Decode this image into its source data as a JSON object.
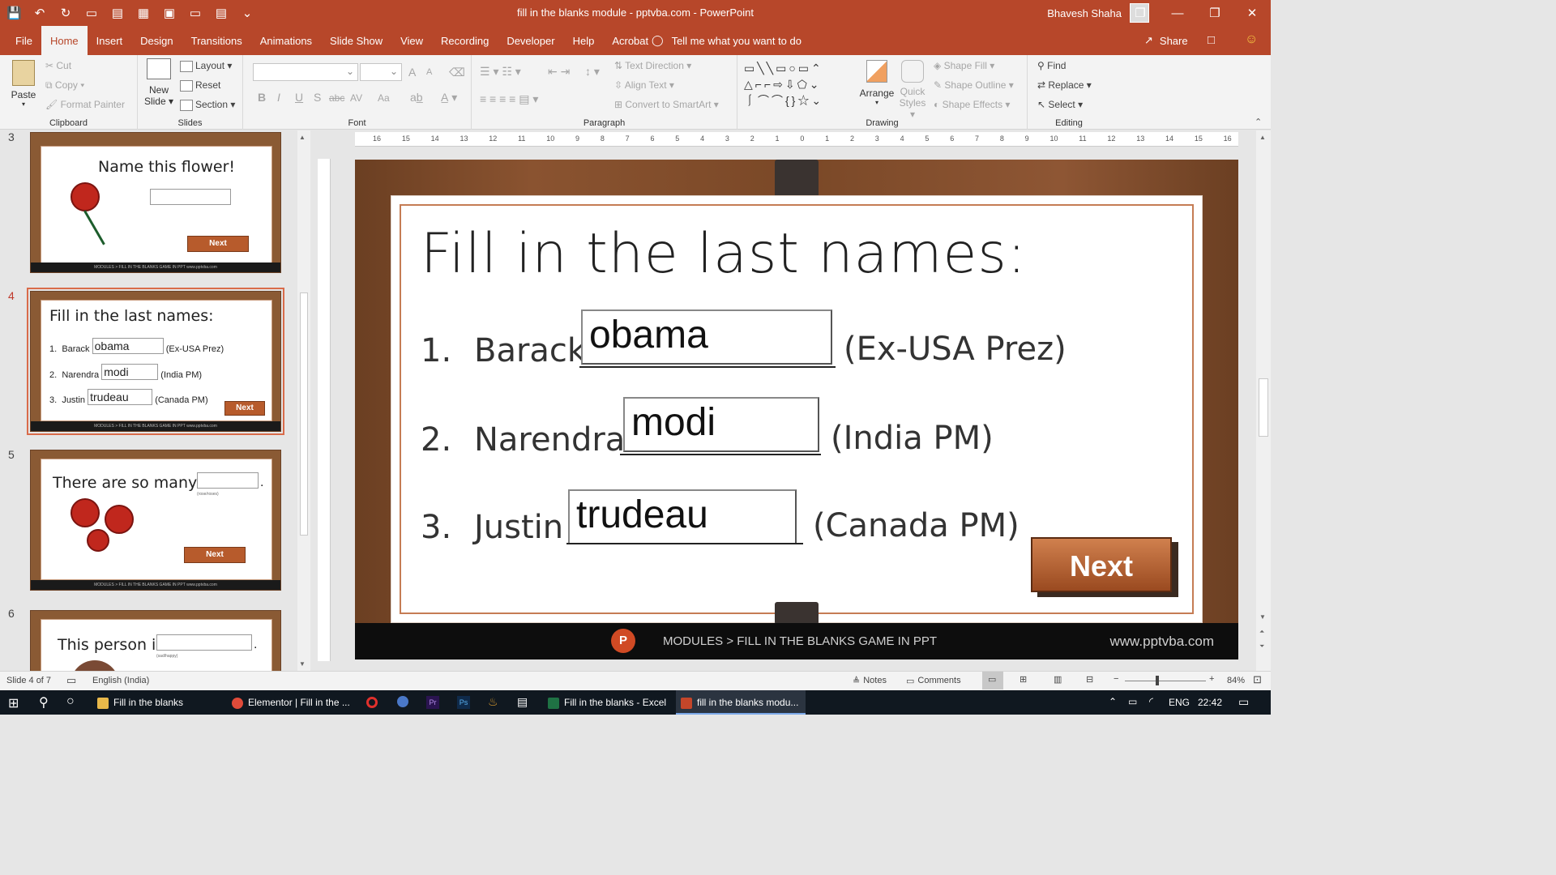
{
  "window": {
    "title": "fill in the blanks module - pptvba.com  -  PowerPoint",
    "user": "Bhavesh Shaha",
    "controls": [
      "❐",
      "—",
      "❐",
      "✕"
    ]
  },
  "quick_access": [
    "💾",
    "↶",
    "↻",
    "▭",
    "▤",
    "▦",
    "▣",
    "▭",
    "▤",
    "⌄"
  ],
  "tabs": [
    "File",
    "Home",
    "Insert",
    "Design",
    "Transitions",
    "Animations",
    "Slide Show",
    "View",
    "Recording",
    "Developer",
    "Help",
    "Acrobat"
  ],
  "tell_me": "Tell me what you want to do",
  "share": "Share",
  "ribbon": {
    "clipboard": {
      "label": "Clipboard",
      "paste": "Paste",
      "cut": "Cut",
      "copy": "Copy",
      "format_painter": "Format Painter"
    },
    "slides": {
      "label": "Slides",
      "new_slide_1": "New",
      "new_slide_2": "Slide",
      "layout": "Layout",
      "reset": "Reset",
      "section": "Section"
    },
    "font": {
      "label": "Font",
      "bold": "B",
      "italic": "I",
      "underline": "U",
      "shadow": "S",
      "strike": "abc",
      "spacing": "AV",
      "case": "Aa",
      "grow": "A",
      "shrink": "A"
    },
    "paragraph": {
      "label": "Paragraph",
      "text_direction": "Text Direction",
      "align_text": "Align Text",
      "convert": "Convert to SmartArt"
    },
    "drawing": {
      "label": "Drawing",
      "arrange": "Arrange",
      "quick_styles_1": "Quick",
      "quick_styles_2": "Styles",
      "shape_fill": "Shape Fill",
      "shape_outline": "Shape Outline",
      "shape_effects": "Shape Effects"
    },
    "editing": {
      "label": "Editing",
      "find": "Find",
      "replace": "Replace",
      "select": "Select"
    }
  },
  "ruler_ticks": [
    "16",
    "15",
    "14",
    "13",
    "12",
    "11",
    "10",
    "9",
    "8",
    "7",
    "6",
    "5",
    "4",
    "3",
    "2",
    "1",
    "0",
    "1",
    "2",
    "3",
    "4",
    "5",
    "6",
    "7",
    "8",
    "9",
    "10",
    "11",
    "12",
    "13",
    "14",
    "15",
    "16"
  ],
  "thumbnails": [
    {
      "num": "3",
      "title": "Name this flower!",
      "next": "Next",
      "footer": "MODULES > FILL IN THE BLANKS GAME IN PPT          www.pptvba.com"
    },
    {
      "num": "4",
      "title": "Fill in the last names:",
      "rows": [
        {
          "n": "1.",
          "first": "Barack",
          "value": "obama",
          "hint": "(Ex-USA Prez)"
        },
        {
          "n": "2.",
          "first": "Narendra",
          "value": "modi",
          "hint": "(India PM)"
        },
        {
          "n": "3.",
          "first": "Justin",
          "value": "trudeau",
          "hint": "(Canada PM)"
        }
      ],
      "next": "Next",
      "footer": "MODULES > FILL IN THE BLANKS GAME IN PPT          www.pptvba.com"
    },
    {
      "num": "5",
      "title": "There are so many",
      "dot": ".",
      "sub": "(rose/roses)",
      "next": "Next",
      "footer": "MODULES > FILL IN THE BLANKS GAME IN PPT          www.pptvba.com"
    },
    {
      "num": "6",
      "title": "This person is",
      "dot": ".",
      "sub": "(sad/happy)"
    }
  ],
  "slide": {
    "title": "Fill in the last names:",
    "rows": [
      {
        "n": "1.",
        "first": "Barack",
        "value": "obama",
        "hint": "(Ex-USA Prez)"
      },
      {
        "n": "2.",
        "first": "Narendra",
        "value": "modi",
        "hint": "(India PM)"
      },
      {
        "n": "3.",
        "first": "Justin",
        "value": "trudeau",
        "hint": "(Canada PM)"
      }
    ],
    "next": "Next",
    "footer_logo": "P",
    "footer_text": "MODULES > FILL IN THE BLANKS GAME IN PPT",
    "footer_url": "www.pptvba.com"
  },
  "status": {
    "slide_of": "Slide 4 of 7",
    "language": "English (India)",
    "notes": "Notes",
    "comments": "Comments",
    "zoom": "84%",
    "zoom_minus": "−",
    "zoom_plus": "+"
  },
  "taskbar": {
    "items": [
      "Fill in the blanks",
      "Elementor | Fill in the ...",
      "Fill in the blanks - Excel",
      "fill in the blanks modu..."
    ],
    "lang": "ENG",
    "time": "22:42"
  },
  "colors": {
    "accent": "#b7472a",
    "wood": "#7a4827",
    "button": "#b75b2c"
  }
}
